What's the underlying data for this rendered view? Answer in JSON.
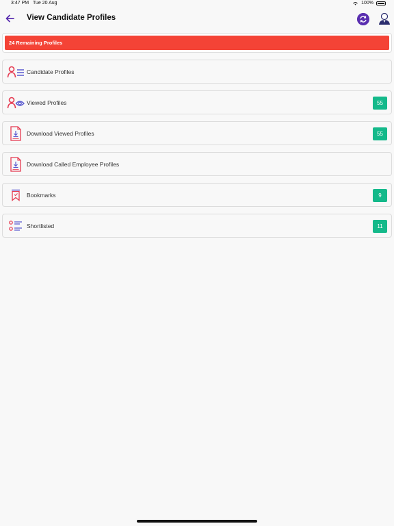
{
  "status": {
    "time": "3:47 PM",
    "date": "Tue 20 Aug",
    "battery": "100%"
  },
  "header": {
    "title": "View Candidate Profiles"
  },
  "banner": {
    "text": "24 Remaining Profiles"
  },
  "items": [
    {
      "label": "Candidate Profiles",
      "badge": null,
      "icon": "profile-list-icon"
    },
    {
      "label": "Viewed Profiles",
      "badge": "55",
      "icon": "profile-eye-icon"
    },
    {
      "label": "Download Viewed Profiles",
      "badge": "55",
      "icon": "download-document-icon"
    },
    {
      "label": "Download Called Employee Profiles",
      "badge": null,
      "icon": "download-document-icon"
    },
    {
      "label": "Bookmarks",
      "badge": "9",
      "icon": "bookmark-icon"
    },
    {
      "label": "Shortlisted",
      "badge": "11",
      "icon": "checklist-icon"
    }
  ],
  "colors": {
    "banner": "#f44336",
    "badge": "#14b98a",
    "accent": "#5a2fb0"
  }
}
